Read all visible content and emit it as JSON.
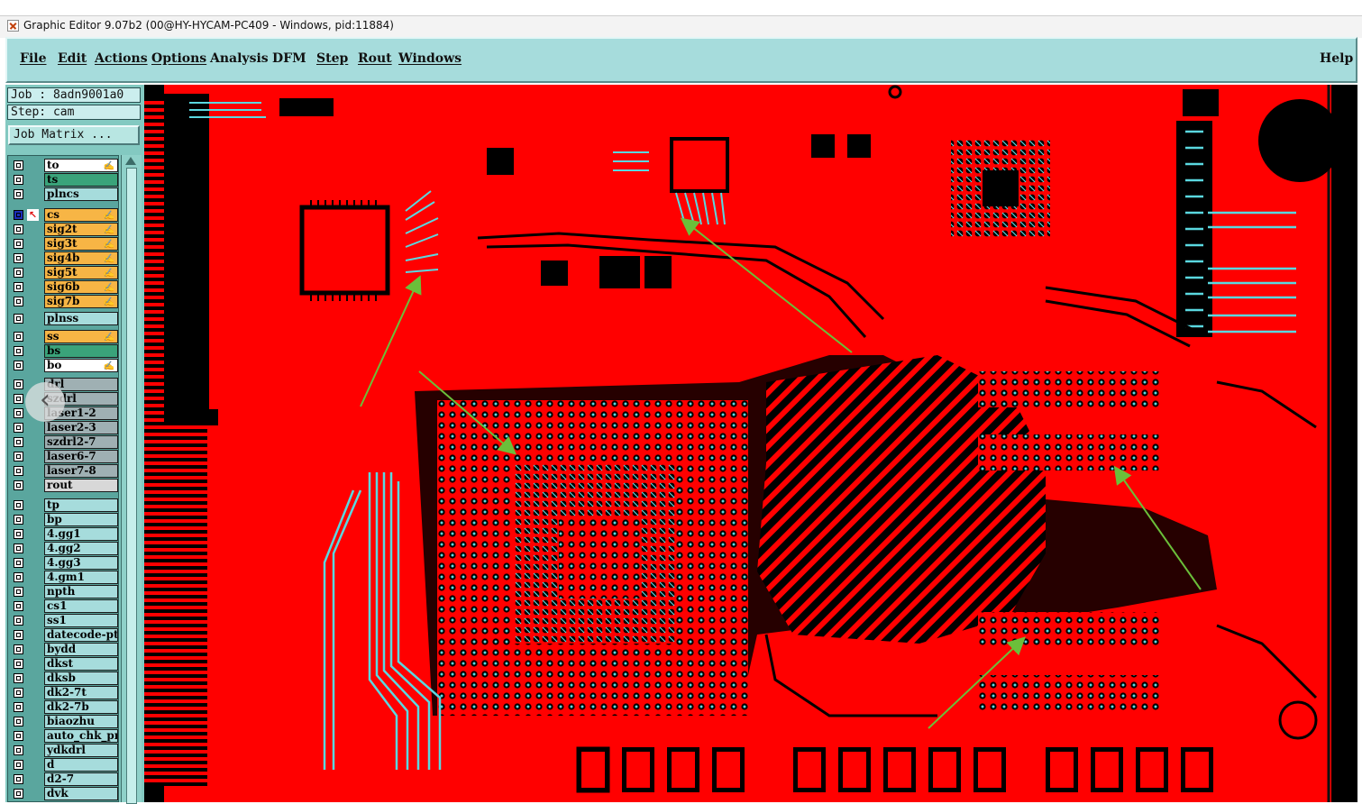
{
  "window": {
    "title": "Graphic Editor 9.07b2 (00@HY-HYCAM-PC409 - Windows, pid:11884)",
    "icon": "app-editor-icon"
  },
  "menu": {
    "items": [
      "File",
      "Edit",
      "Actions",
      "Options",
      "Analysis",
      "DFM",
      "Step",
      "Rout",
      "Windows"
    ],
    "help": "Help"
  },
  "job": {
    "job_line": "Job : 8adn9001a0",
    "step_line": "Step: cam",
    "matrix_button": "Job Matrix ..."
  },
  "layers": [
    {
      "name": "to",
      "color": "#ffffff",
      "affect": "✍"
    },
    {
      "name": "ts",
      "color": "#3aa37a",
      "affect": ""
    },
    {
      "name": "plncs",
      "color": "#a6dcdc",
      "affect": ""
    },
    {
      "name": "cs",
      "color": "#f7b545",
      "affect": "✍",
      "work": true
    },
    {
      "name": "sig2t",
      "color": "#f7b545",
      "affect": "✍"
    },
    {
      "name": "sig3t",
      "color": "#f7b545",
      "affect": "✍"
    },
    {
      "name": "sig4b",
      "color": "#f7b545",
      "affect": "✍"
    },
    {
      "name": "sig5t",
      "color": "#f7b545",
      "affect": "✍"
    },
    {
      "name": "sig6b",
      "color": "#f7b545",
      "affect": "✍"
    },
    {
      "name": "sig7b",
      "color": "#f7b545",
      "affect": "✍"
    },
    {
      "name": "plnss",
      "color": "#a6dcdc",
      "affect": ""
    },
    {
      "name": "ss",
      "color": "#f7b545",
      "affect": "✍"
    },
    {
      "name": "bs",
      "color": "#3aa37a",
      "affect": ""
    },
    {
      "name": "bo",
      "color": "#ffffff",
      "affect": "✍"
    },
    {
      "name": "drl",
      "color": "#9fb0b3",
      "affect": ""
    },
    {
      "name": "szdrl",
      "color": "#9fb0b3",
      "affect": ""
    },
    {
      "name": "laser1-2",
      "color": "#9fb0b3",
      "affect": ""
    },
    {
      "name": "laser2-3",
      "color": "#9fb0b3",
      "affect": ""
    },
    {
      "name": "szdrl2-7",
      "color": "#9fb0b3",
      "affect": ""
    },
    {
      "name": "laser6-7",
      "color": "#9fb0b3",
      "affect": ""
    },
    {
      "name": "laser7-8",
      "color": "#9fb0b3",
      "affect": ""
    },
    {
      "name": "rout",
      "color": "#d8d8d8",
      "affect": ""
    },
    {
      "name": "tp",
      "color": "#a6dcdc",
      "affect": ""
    },
    {
      "name": "bp",
      "color": "#a6dcdc",
      "affect": ""
    },
    {
      "name": "4.gg1",
      "color": "#a6dcdc",
      "affect": ""
    },
    {
      "name": "4.gg2",
      "color": "#a6dcdc",
      "affect": ""
    },
    {
      "name": "4.gg3",
      "color": "#a6dcdc",
      "affect": ""
    },
    {
      "name": "4.gm1",
      "color": "#a6dcdc",
      "affect": ""
    },
    {
      "name": "npth",
      "color": "#a6dcdc",
      "affect": ""
    },
    {
      "name": "cs1",
      "color": "#a6dcdc",
      "affect": ""
    },
    {
      "name": "ss1",
      "color": "#a6dcdc",
      "affect": ""
    },
    {
      "name": "datecode-pto",
      "color": "#a6dcdc",
      "affect": ""
    },
    {
      "name": "bydd",
      "color": "#a6dcdc",
      "affect": ""
    },
    {
      "name": "dkst",
      "color": "#a6dcdc",
      "affect": ""
    },
    {
      "name": "dksb",
      "color": "#a6dcdc",
      "affect": ""
    },
    {
      "name": "dk2-7t",
      "color": "#a6dcdc",
      "affect": ""
    },
    {
      "name": "dk2-7b",
      "color": "#a6dcdc",
      "affect": ""
    },
    {
      "name": "biaozhu",
      "color": "#a6dcdc",
      "affect": ""
    },
    {
      "name": "auto_chk_pn",
      "color": "#a6dcdc",
      "affect": ""
    },
    {
      "name": "ydkdrl",
      "color": "#a6dcdc",
      "affect": ""
    },
    {
      "name": "d",
      "color": "#a6dcdc",
      "affect": ""
    },
    {
      "name": "d2-7",
      "color": "#a6dcdc",
      "affect": ""
    },
    {
      "name": "dvk",
      "color": "#a6dcdc",
      "affect": ""
    }
  ],
  "colors": {
    "copper": "#ff0000",
    "trace": "#5ad8e0",
    "annotation_arrow": "#6bbf3a",
    "background": "#000000"
  }
}
